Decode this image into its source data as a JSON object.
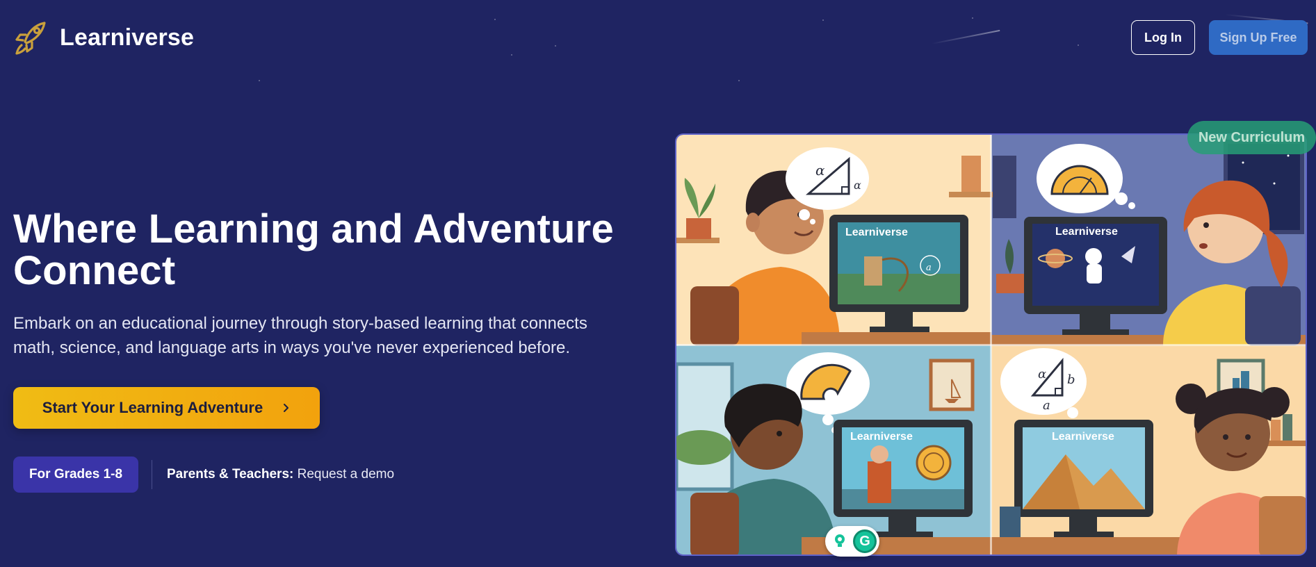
{
  "brand": {
    "name": "Learniverse",
    "icon": "rocket-icon"
  },
  "nav": {
    "login_label": "Log In",
    "signup_label": "Sign Up Free"
  },
  "hero": {
    "title": "Where Learning and Adventure Connect",
    "subtitle": "Embark on an educational journey through story-based learning that connects math, science, and language arts in ways you've never experienced before.",
    "cta_label": "Start Your Learning Adventure",
    "cta_icon": "chevron-right-icon",
    "grades_badge": "For Grades 1-8",
    "demo_prefix": "Parents & Teachers:",
    "demo_link": "Request a demo"
  },
  "illustration": {
    "badge": "New Curriculum",
    "screen_brand": "Learniverse",
    "labels": {
      "alpha": "α",
      "a": "a",
      "b": "b"
    }
  },
  "extension": {
    "icons": [
      "lightbulb-icon",
      "grammarly-icon"
    ],
    "g_letter": "G"
  },
  "colors": {
    "background": "#1f2462",
    "accent": "#f0bc14",
    "signup": "#2f6ac4",
    "badge": "#3a34a8",
    "new_badge": "#279d76"
  }
}
